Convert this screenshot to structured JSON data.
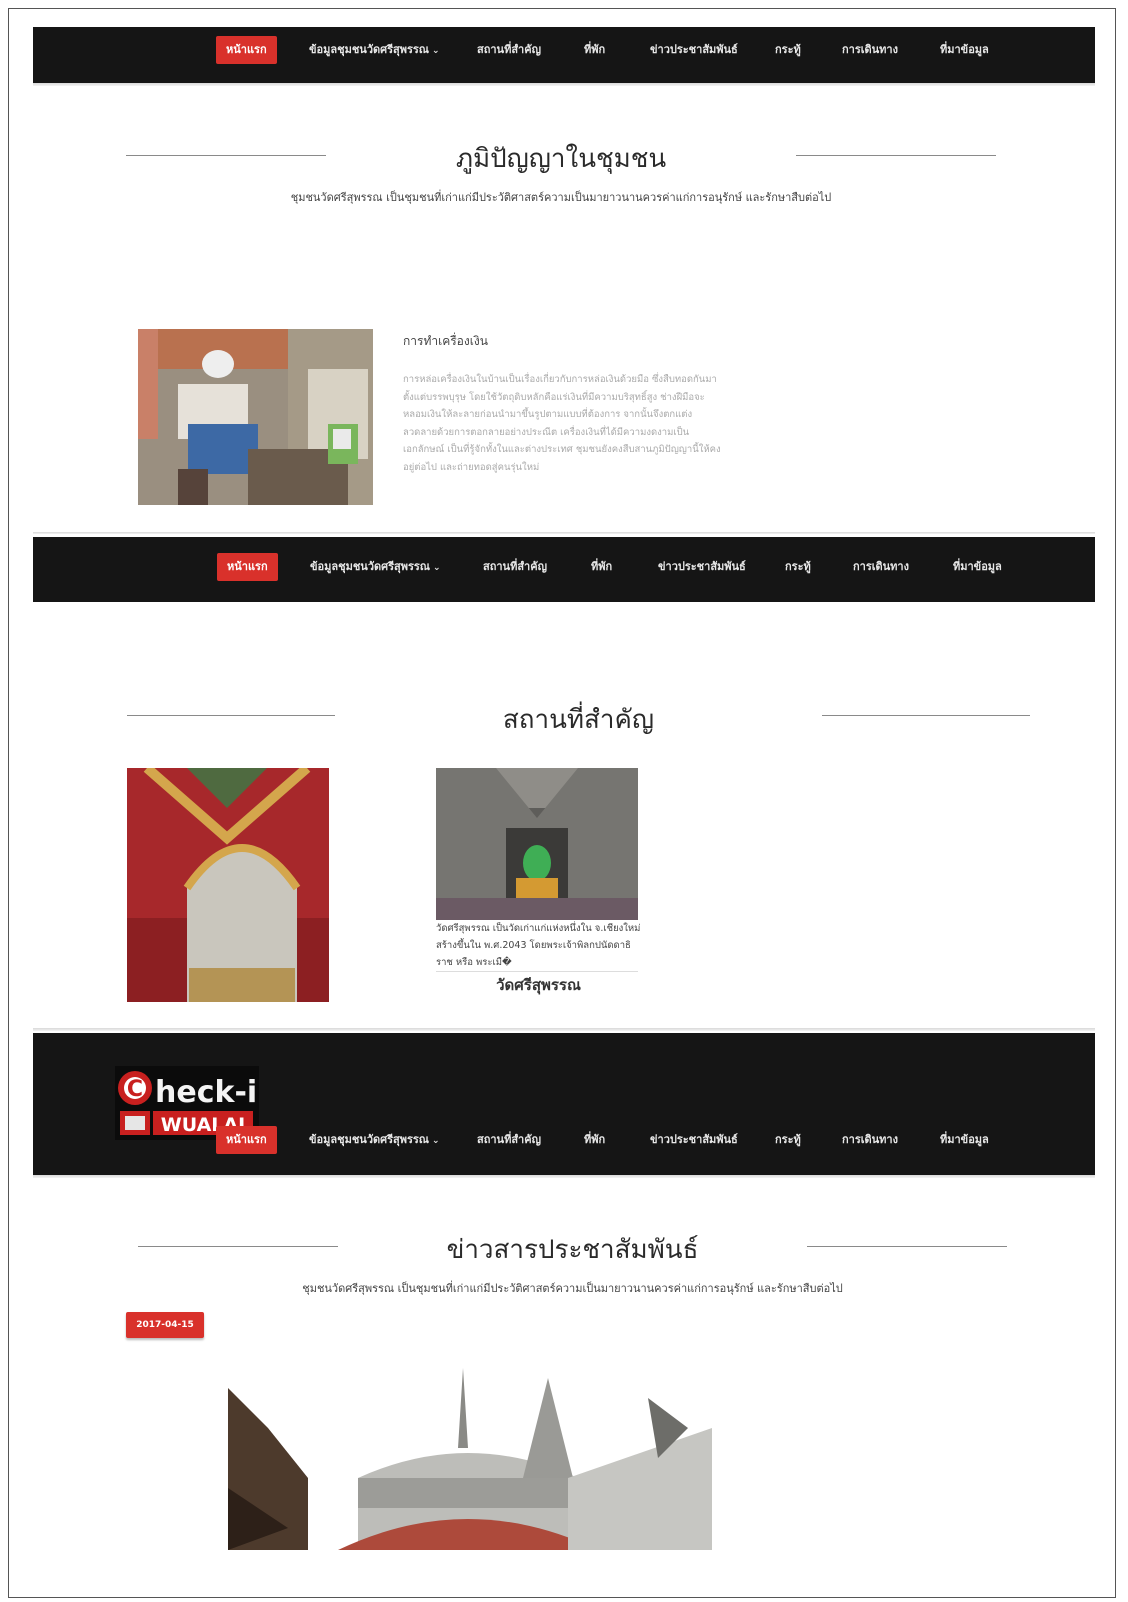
{
  "nav": {
    "items": [
      {
        "label": "หน้าแรก",
        "active": true
      },
      {
        "label": "ข้อมูลชุมชนวัดศรีสุพรรณ",
        "dropdown": true
      },
      {
        "label": "สถานที่สำคัญ"
      },
      {
        "label": "ที่พัก"
      },
      {
        "label": "ข่าวประชาสัมพันธ์"
      },
      {
        "label": "กระทู้"
      },
      {
        "label": "การเดินทาง"
      },
      {
        "label": "ที่มาข้อมูล"
      }
    ],
    "caret_icon": "chevron-down-icon",
    "bg_color": "#151515",
    "active_color": "#d9312b"
  },
  "wisdom": {
    "title": "ภูมิปัญญาในชุมชน",
    "subtitle": "ชุมชนวัดศรีสุพรรณ เป็นชุมชนที่เก่าแก่มีประวัติศาสตร์ความเป็นมายาวนานควรค่าแก่การอนุรักษ์ และรักษาสืบต่อไป",
    "card": {
      "heading": "การทำเครื่องเงิน",
      "body": "การหล่อเครื่องเงินในบ้านเป็นเรื่องเกี่ยวกับการหล่อเงินด้วยมือ ซึ่งสืบทอดกันมาตั้งแต่บรรพบุรุษ โดยใช้วัตถุดิบหลักคือแร่เงินที่มีความบริสุทธิ์สูง ช่างฝีมือจะหลอมเงินให้ละลายก่อนนำมาขึ้นรูปตามแบบที่ต้องการ จากนั้นจึงตกแต่งลวดลายด้วยการตอกลายอย่างประณีต เครื่องเงินที่ได้มีความงดงามเป็นเอกลักษณ์ เป็นที่รู้จักทั้งในและต่างประเทศ ชุมชนยังคงสืบสานภูมิปัญญานี้ให้คงอยู่ต่อไป และถ่ายทอดสู่คนรุ่นใหม่"
    }
  },
  "places": {
    "title": "สถานที่สำคัญ",
    "items": [
      {
        "caption": "",
        "name": ""
      },
      {
        "caption": "วัดศรีสุพรรณ เป็นวัดเก่าแก่แห่งหนึ่งใน จ.เชียงใหม่ สร้างขึ้นใน พ.ศ.2043 โดยพระเจ้าพิลกปนัดดาธิราช หรือ พระเมื�",
        "name": "วัดศรีสุพรรณ"
      }
    ]
  },
  "news": {
    "logo": {
      "word1": "heck-in",
      "initial": "C",
      "word2": "WUALAI"
    },
    "title": "ข่าวสารประชาสัมพันธ์",
    "subtitle": "ชุมชนวัดศรีสุพรรณ เป็นชุมชนที่เก่าแก่มีประวัติศาสตร์ความเป็นมายาวนานควรค่าแก่การอนุรักษ์ และรักษาสืบต่อไป",
    "date": "2017-04-15"
  }
}
